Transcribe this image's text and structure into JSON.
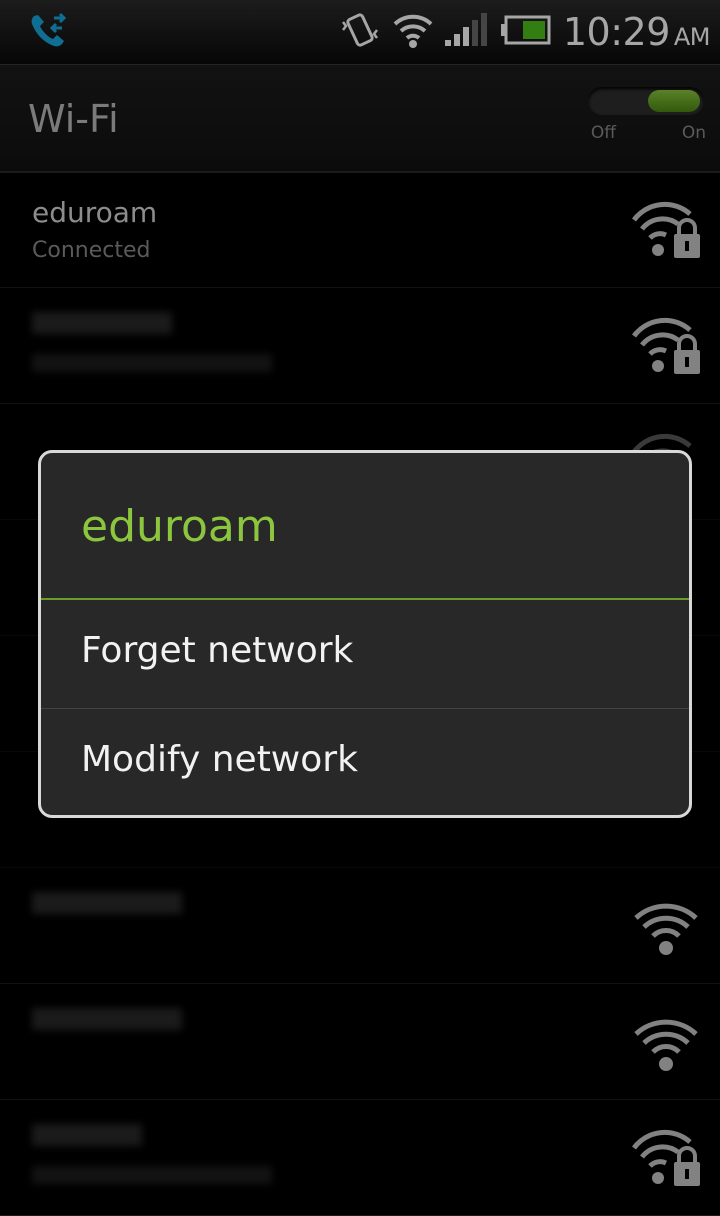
{
  "status_bar": {
    "time": "10:29",
    "ampm": "AM",
    "icons": [
      "call-forward-icon",
      "vibrate-icon",
      "wifi-signal-icon",
      "cell-signal-icon",
      "battery-icon"
    ]
  },
  "header": {
    "title": "Wi-Fi",
    "toggle_off_label": "Off",
    "toggle_on_label": "On",
    "toggle_state": "on"
  },
  "networks": [
    {
      "name": "eduroam",
      "status": "Connected",
      "secured": true
    },
    {
      "name": "",
      "status": "",
      "secured": true
    },
    {
      "name": "",
      "status": "",
      "secured": true
    },
    {
      "name": "",
      "status": "",
      "secured": false
    },
    {
      "name": "",
      "status": "",
      "secured": false
    },
    {
      "name": "",
      "status": "",
      "secured": false
    },
    {
      "name": "",
      "status": "",
      "secured": false
    },
    {
      "name": "",
      "status": "",
      "secured": false
    },
    {
      "name": "",
      "status": "",
      "secured": true
    }
  ],
  "dialog": {
    "title": "eduroam",
    "items": [
      "Forget network",
      "Modify network"
    ]
  },
  "colors": {
    "accent": "#8cc63f",
    "dialog_bg": "#282828",
    "battery": "#4fc21c"
  }
}
